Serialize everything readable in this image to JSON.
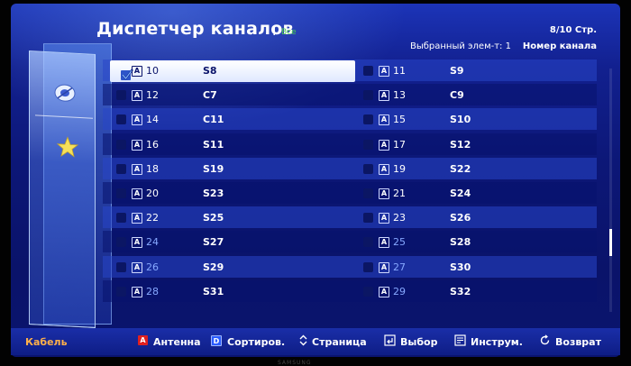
{
  "header": {
    "title": "Диспетчер каналов",
    "title_sep": "I",
    "title_sub": "Все",
    "page": "8/10 Стр.",
    "selected_label": "Выбранный элем-т: 1",
    "sort_label": "Номер канала"
  },
  "panel": {
    "icons": [
      "satellite-icon",
      "star-icon"
    ]
  },
  "channels": {
    "left": [
      {
        "num": "10",
        "name": "S8",
        "checked": true,
        "selected": true
      },
      {
        "num": "12",
        "name": "C7"
      },
      {
        "num": "14",
        "name": "C11"
      },
      {
        "num": "16",
        "name": "S11"
      },
      {
        "num": "18",
        "name": "S19"
      },
      {
        "num": "20",
        "name": "S23"
      },
      {
        "num": "22",
        "name": "S25"
      },
      {
        "num": "24",
        "name": "S27"
      },
      {
        "num": "26",
        "name": "S29"
      },
      {
        "num": "28",
        "name": "S31"
      }
    ],
    "right": [
      {
        "num": "11",
        "name": "S9"
      },
      {
        "num": "13",
        "name": "C9"
      },
      {
        "num": "15",
        "name": "S10"
      },
      {
        "num": "17",
        "name": "S12"
      },
      {
        "num": "19",
        "name": "S22"
      },
      {
        "num": "21",
        "name": "S24"
      },
      {
        "num": "23",
        "name": "S26"
      },
      {
        "num": "25",
        "name": "S28"
      },
      {
        "num": "27",
        "name": "S30"
      },
      {
        "num": "29",
        "name": "S32"
      }
    ],
    "antenna_glyph": "A"
  },
  "footer": {
    "source": "Кабель",
    "antenna_key": "A",
    "antenna": "Антенна",
    "sort_key": "D",
    "sort": "Сортиров.",
    "page": "Страница",
    "select": "Выбор",
    "tools": "Инструм.",
    "back": "Возврат"
  },
  "brand": "SAMSUNG",
  "colors": {
    "accent": "#ffb04a",
    "selected_row": "#ffffff",
    "red_key": "#e02020",
    "blue_key": "#2a5cff"
  }
}
